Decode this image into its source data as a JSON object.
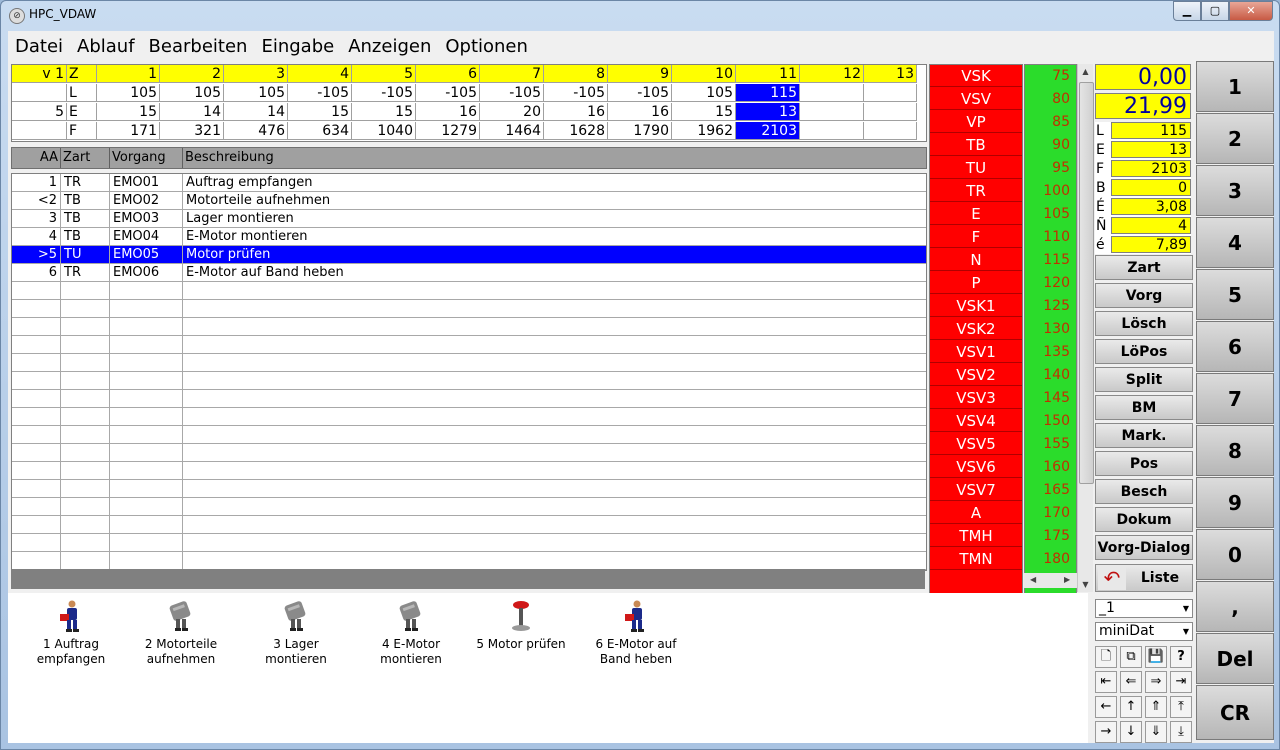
{
  "window": {
    "title": "HPC_VDAW"
  },
  "menu": [
    "Datei",
    "Ablauf",
    "Bearbeiten",
    "Eingabe",
    "Anzeigen",
    "Optionen"
  ],
  "grid": {
    "header": [
      "v 1",
      "Z",
      "1",
      "2",
      "3",
      "4",
      "5",
      "6",
      "7",
      "8",
      "9",
      "10",
      "11",
      "12",
      "13"
    ],
    "rows": [
      {
        "a": "",
        "z": "L",
        "vals": [
          "105",
          "105",
          "105",
          "-105",
          "-105",
          "-105",
          "-105",
          "-105",
          "-105",
          "105",
          "115",
          "",
          ""
        ]
      },
      {
        "a": "5",
        "z": "E",
        "vals": [
          "15",
          "14",
          "14",
          "15",
          "15",
          "16",
          "20",
          "16",
          "16",
          "15",
          "13",
          "",
          ""
        ]
      },
      {
        "a": "",
        "z": "F",
        "vals": [
          "171",
          "321",
          "476",
          "634",
          "1040",
          "1279",
          "1464",
          "1628",
          "1790",
          "1962",
          "2103",
          "",
          ""
        ]
      }
    ]
  },
  "table": {
    "columns": [
      "AA",
      "Zart",
      "Vorgang",
      "Beschreibung"
    ],
    "rows": [
      {
        "aa": "1",
        "zart": "TR",
        "vorgang": "EMO01",
        "beschreibung": "Auftrag empfangen"
      },
      {
        "aa": "<2",
        "zart": "TB",
        "vorgang": "EMO02",
        "beschreibung": "Motorteile aufnehmen"
      },
      {
        "aa": "3",
        "zart": "TB",
        "vorgang": "EMO03",
        "beschreibung": "Lager montieren"
      },
      {
        "aa": "4",
        "zart": "TB",
        "vorgang": "EMO04",
        "beschreibung": "E-Motor montieren"
      },
      {
        "aa": ">5",
        "zart": "TU",
        "vorgang": "EMO05",
        "beschreibung": "Motor prüfen"
      },
      {
        "aa": "6",
        "zart": "TR",
        "vorgang": "EMO06",
        "beschreibung": "E-Motor auf Band heben"
      }
    ],
    "selected_index": 4
  },
  "red_list": [
    "VSK",
    "VSV",
    "VP",
    "TB",
    "TU",
    "TR",
    "E",
    "F",
    "N",
    "P",
    "VSK1",
    "VSK2",
    "VSV1",
    "VSV2",
    "VSV3",
    "VSV4",
    "VSV5",
    "VSV6",
    "VSV7",
    "A",
    "TMH",
    "TMN"
  ],
  "green_list": [
    "75",
    "80",
    "85",
    "90",
    "95",
    "100",
    "105",
    "110",
    "115",
    "120",
    "125",
    "130",
    "135",
    "140",
    "145",
    "150",
    "155",
    "160",
    "165",
    "170",
    "175",
    "180"
  ],
  "values": {
    "top1": "0,00",
    "top2": "21,99"
  },
  "info": [
    {
      "k": "L",
      "v": "115"
    },
    {
      "k": "E",
      "v": "13"
    },
    {
      "k": "F",
      "v": "2103"
    },
    {
      "k": "B",
      "v": "0"
    },
    {
      "k": "É",
      "v": "3,08"
    },
    {
      "k": "Ñ",
      "v": "4"
    },
    {
      "k": "é",
      "v": "7,89"
    }
  ],
  "actions": [
    "Zart",
    "Vorg",
    "Lösch",
    "LöPos",
    "Split",
    "BM",
    "Mark.",
    "Pos",
    "Besch",
    "Dokum",
    "Vorg-Dialog"
  ],
  "liste_label": "Liste",
  "selects": {
    "first": "_1",
    "second": "miniDat"
  },
  "numpad": [
    "1",
    "2",
    "3",
    "4",
    "5",
    "6",
    "7",
    "8",
    "9",
    "0",
    ",",
    "Del",
    "CR"
  ],
  "strip": [
    {
      "label": "1 Auftrag empfangen",
      "icon": "worker-icon"
    },
    {
      "label": "2 Motorteile aufnehmen",
      "icon": "motor-part-icon"
    },
    {
      "label": "3 Lager montieren",
      "icon": "motor-part-icon"
    },
    {
      "label": "4 E-Motor montieren",
      "icon": "motor-part-icon"
    },
    {
      "label": "5 Motor prüfen",
      "icon": "inspection-stand-icon"
    },
    {
      "label": "6 E-Motor auf Band heben",
      "icon": "worker-icon"
    }
  ],
  "colors": {
    "yellow": "#ffff00",
    "selection": "#0000ff",
    "red": "#ff0000",
    "green": "#2bdc2b"
  }
}
